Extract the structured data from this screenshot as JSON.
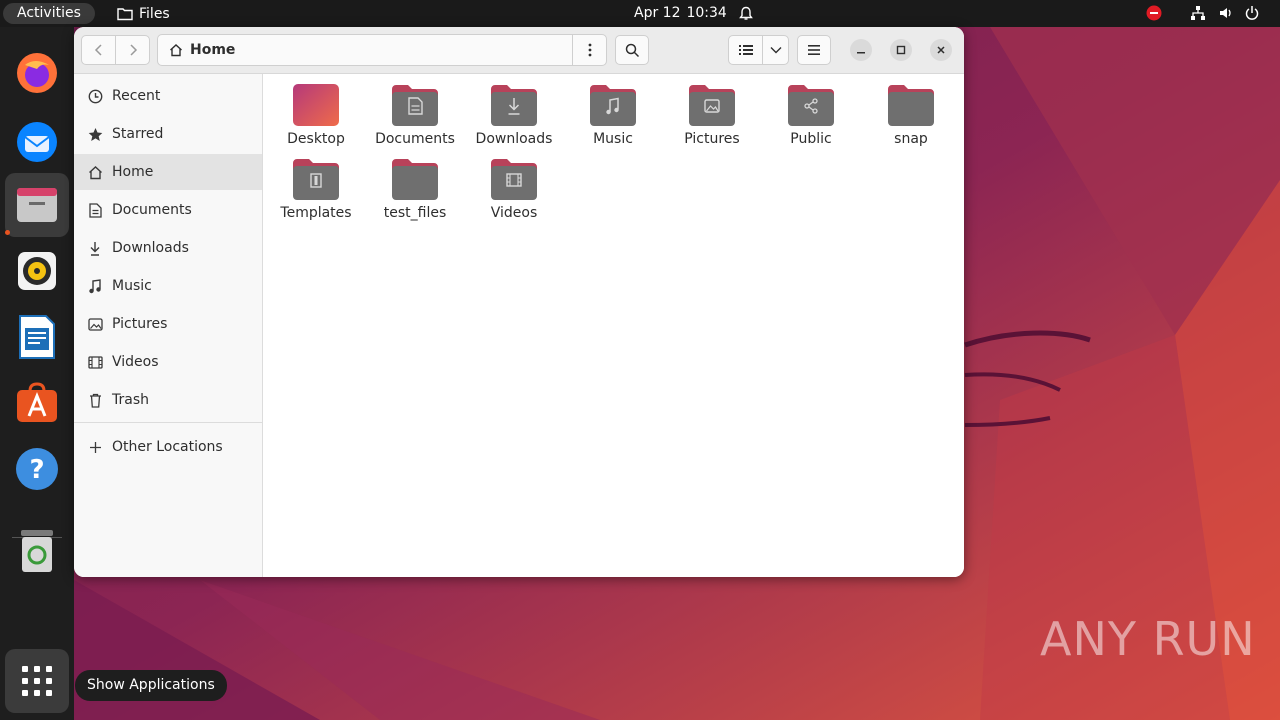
{
  "topbar": {
    "activities_label": "Activities",
    "app_name": "Files",
    "date": "Apr 12",
    "time": "10:34"
  },
  "dock": {
    "items": [
      "firefox-icon",
      "thunderbird-icon",
      "files-icon",
      "rhythmbox-icon",
      "writer-icon",
      "app-center-icon",
      "help-icon",
      "trash-icon"
    ],
    "tooltip": "Show Applications"
  },
  "window": {
    "path": "Home"
  },
  "sidebar": {
    "items": [
      {
        "label": "Recent",
        "icon": "clock-icon"
      },
      {
        "label": "Starred",
        "icon": "star-icon"
      },
      {
        "label": "Home",
        "icon": "home-icon"
      },
      {
        "label": "Documents",
        "icon": "document-icon"
      },
      {
        "label": "Downloads",
        "icon": "download-icon"
      },
      {
        "label": "Music",
        "icon": "music-icon"
      },
      {
        "label": "Pictures",
        "icon": "picture-icon"
      },
      {
        "label": "Videos",
        "icon": "video-icon"
      },
      {
        "label": "Trash",
        "icon": "trash-icon"
      }
    ],
    "other_locations": "Other Locations"
  },
  "files": [
    {
      "name": "Desktop",
      "icon": "desktop-folder-icon"
    },
    {
      "name": "Documents",
      "icon": "documents-folder-icon"
    },
    {
      "name": "Downloads",
      "icon": "downloads-folder-icon"
    },
    {
      "name": "Music",
      "icon": "music-folder-icon"
    },
    {
      "name": "Pictures",
      "icon": "pictures-folder-icon"
    },
    {
      "name": "Public",
      "icon": "public-folder-icon"
    },
    {
      "name": "snap",
      "icon": "folder-icon"
    },
    {
      "name": "Templates",
      "icon": "templates-folder-icon"
    },
    {
      "name": "test_files",
      "icon": "folder-icon"
    },
    {
      "name": "Videos",
      "icon": "videos-folder-icon"
    }
  ],
  "watermark": "ANY RUN",
  "colors": {
    "accent": "#e95420",
    "folder_top": "#b8425a",
    "folder_body": "#6f6f6f"
  }
}
